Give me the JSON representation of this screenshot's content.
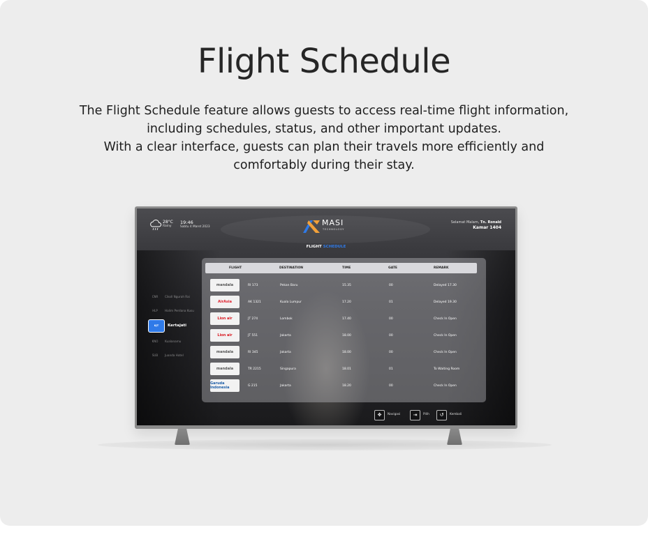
{
  "heading": "Flight Schedule",
  "description": [
    "The Flight Schedule feature allows guests to access real-time flight information,",
    "including schedules, status, and other important updates.",
    "With a clear interface, guests can plan their travels more efficiently and",
    "comfortably during their stay."
  ],
  "tv": {
    "weather": {
      "temp": "28°C",
      "condition": "Rainy",
      "icon": "cloud-rain-icon"
    },
    "time": "19:46",
    "date": "Sabtu 4 Maret 2023",
    "brand": {
      "name": "MASI",
      "sub": "TECHNOLOGY"
    },
    "greeting": {
      "prefix": "Selamat Malam,",
      "name": "Tn. Ronald"
    },
    "room": "Kamar 1404",
    "page_title": {
      "main": "FLIGHT",
      "accent": "SCHEDULE"
    },
    "sidebar": [
      {
        "label": "Cikoll Ngurah Rai",
        "icon": "airport-logo-icon",
        "icon_text": "CNR"
      },
      {
        "label": "Halim Perdana Kusu",
        "icon": "airport-logo-icon",
        "icon_text": "HLP"
      },
      {
        "label": "Kertajati",
        "icon": "airport-logo-icon",
        "icon_text": "KJT",
        "active": true
      },
      {
        "label": "Kualanamu",
        "icon": "airport-logo-icon",
        "icon_text": "KNO"
      },
      {
        "label": "Juanda Hotel",
        "icon": "airport-logo-icon",
        "icon_text": "SUB"
      }
    ],
    "table": {
      "headers": {
        "flight": "FLIGHT",
        "destination": "DESTINATION",
        "time": "TIME",
        "gate": "GATE",
        "remark": "REMARK"
      },
      "rows": [
        {
          "airline": "mandala",
          "airline_color": "#555555",
          "flight": "RI 173",
          "destination": "Pekan Baru",
          "time": "15.35",
          "gate": "00",
          "remark": "Delayed 17.30"
        },
        {
          "airline": "AirAsia",
          "airline_color": "#e01e2b",
          "flight": "AK 1321",
          "destination": "Kuala Lumpur",
          "time": "17.20",
          "gate": "01",
          "remark": "Delayed 19.30"
        },
        {
          "airline": "Lion air",
          "airline_color": "#d8131b",
          "flight": "JT 274",
          "destination": "Lombok",
          "time": "17.40",
          "gate": "00",
          "remark": "Check In Open"
        },
        {
          "airline": "Lion air",
          "airline_color": "#d8131b",
          "flight": "JT 551",
          "destination": "Jakarta",
          "time": "18.00",
          "gate": "00",
          "remark": "Check In Open"
        },
        {
          "airline": "mandala",
          "airline_color": "#555555",
          "flight": "RI 345",
          "destination": "Jakarta",
          "time": "18.00",
          "gate": "00",
          "remark": "Check In Open"
        },
        {
          "airline": "mandala",
          "airline_color": "#555555",
          "flight": "TR 2215",
          "destination": "Singapura",
          "time": "18.01",
          "gate": "01",
          "remark": "To Waiting Room"
        },
        {
          "airline": "Garuda Indonesia",
          "airline_color": "#1f5fa8",
          "flight": "G 215",
          "destination": "Jakarta",
          "time": "18.20",
          "gate": "00",
          "remark": "Check In Open"
        }
      ]
    },
    "footer": {
      "navigate": "Navigasi",
      "select": "Pilih",
      "back": "Kembali"
    }
  }
}
